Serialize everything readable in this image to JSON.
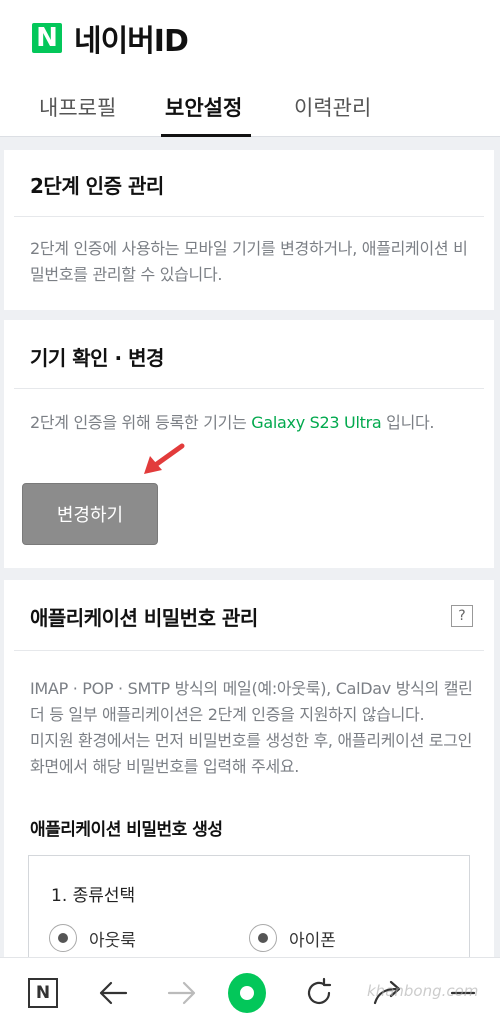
{
  "header": {
    "logo_letter": "N",
    "title": "네이버ID",
    "tabs": [
      {
        "label": "내프로필",
        "active": false
      },
      {
        "label": "보안설정",
        "active": true
      },
      {
        "label": "이력관리",
        "active": false
      }
    ]
  },
  "two_step": {
    "title": "2단계 인증 관리",
    "description": "2단계 인증에 사용하는 모바일 기기를 변경하거나, 애플리케이션 비밀번호를 관리할 수 있습니다."
  },
  "device": {
    "title": "기기 확인 · 변경",
    "desc_before": "2단계 인증을 위해 등록한 기기는 ",
    "device_name": "Galaxy S23 Ultra",
    "desc_after": " 입니다.",
    "change_button": "변경하기"
  },
  "app_password": {
    "title": "애플리케이션 비밀번호 관리",
    "help_label": "?",
    "description1": "IMAP · POP · SMTP 방식의 메일(예:아웃룩), CalDav 방식의 캘린더 등 일부 애플리케이션은 2단계 인증을 지원하지 않습니다.",
    "description2": "미지원 환경에서는 먼저 비밀번호를 생성한 후, 애플리케이션 로그인 화면에서 해당 비밀번호를 입력해 주세요.",
    "generate_title": "애플리케이션 비밀번호 생성",
    "step_label": "1. 종류선택",
    "options": [
      "아웃룩",
      "아이폰"
    ]
  },
  "bottom_nav": {
    "icons": [
      "naver-n-icon",
      "back-arrow-icon",
      "forward-arrow-icon",
      "home-icon",
      "refresh-icon",
      "share-icon",
      "menu-icon"
    ],
    "n_label": "N"
  },
  "watermark": "khanbong.com",
  "colors": {
    "brand_green": "#03c75a",
    "link_green": "#03a94e",
    "button_gray": "#8c8c8c",
    "arrow_red": "#e23b3b"
  }
}
